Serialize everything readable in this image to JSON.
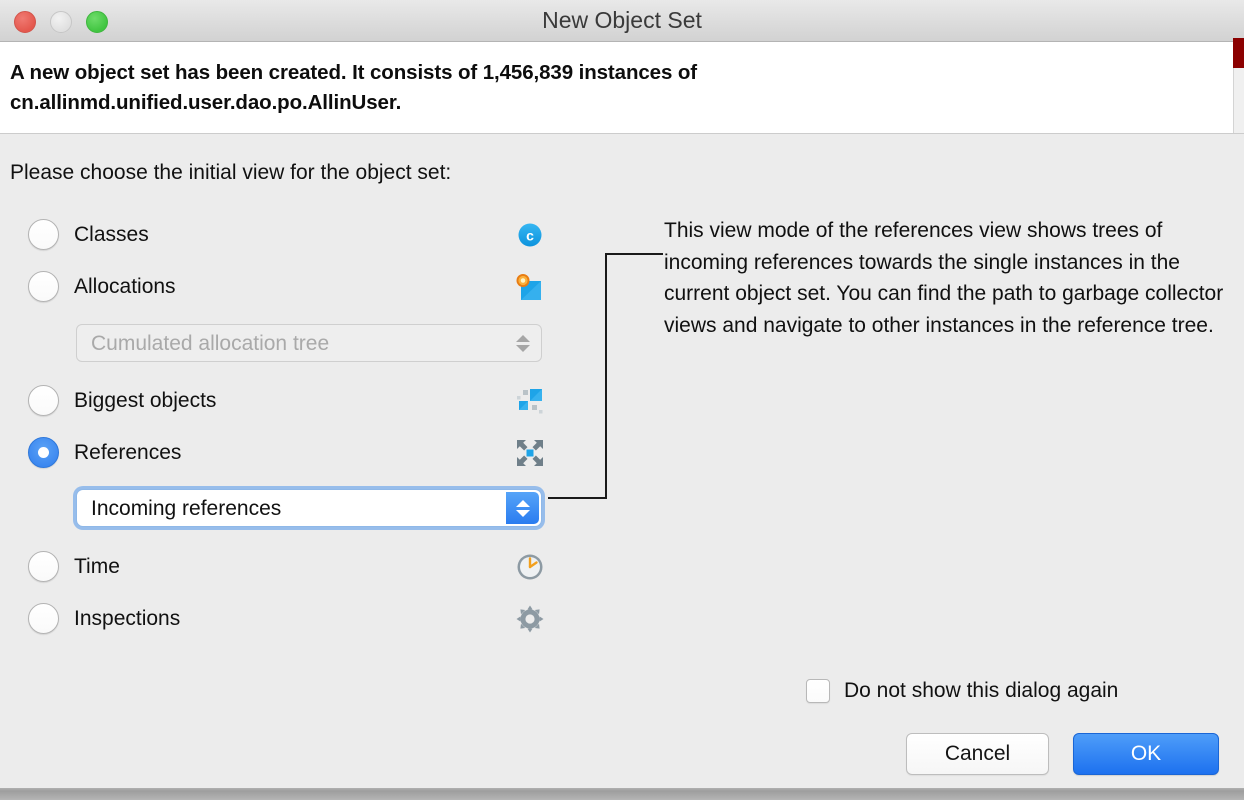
{
  "window": {
    "title": "New Object Set",
    "traffic_lights": [
      "close-button",
      "minimize-button",
      "zoom-button"
    ]
  },
  "header": {
    "message": "A new object set has been created. It consists of 1,456,839 instances of cn.allinmd.unified.user.dao.po.AllinUser."
  },
  "body": {
    "prompt": "Please choose the initial view for the object set:",
    "options": [
      {
        "id": "classes",
        "label": "Classes",
        "icon": "class-icon",
        "selected": false
      },
      {
        "id": "allocations",
        "label": "Allocations",
        "icon": "allocation-icon",
        "selected": false
      },
      {
        "id": "biggest-objects",
        "label": "Biggest objects",
        "icon": "biggest-objects-icon",
        "selected": false
      },
      {
        "id": "references",
        "label": "References",
        "icon": "references-icon",
        "selected": true
      },
      {
        "id": "time",
        "label": "Time",
        "icon": "clock-icon",
        "selected": false
      },
      {
        "id": "inspections",
        "label": "Inspections",
        "icon": "gear-icon",
        "selected": false
      }
    ],
    "allocation_select": {
      "value": "Cumulated allocation tree",
      "enabled": false,
      "options": [
        "Cumulated allocation tree"
      ]
    },
    "references_select": {
      "value": "Incoming references",
      "enabled": true,
      "focused": true,
      "options": [
        "Incoming references"
      ]
    },
    "description": "This view mode of the references view shows trees of incoming references towards the single instances in the current object set. You can find the path to garbage collector views and navigate to other instances in the reference tree."
  },
  "footer": {
    "dont_show_label": "Do not show this dialog again",
    "dont_show_checked": false,
    "cancel_label": "Cancel",
    "ok_label": "OK"
  },
  "colors": {
    "accent_blue": "#2a7cf0",
    "selected_radio": "#3b87f0",
    "window_bg": "#ececec",
    "header_bg": "#ffffff",
    "scroll_marker": "#8b0000",
    "icon_blue": "#1ea4e8",
    "icon_orange": "#f39a1a",
    "icon_gray": "#7f8c94"
  }
}
